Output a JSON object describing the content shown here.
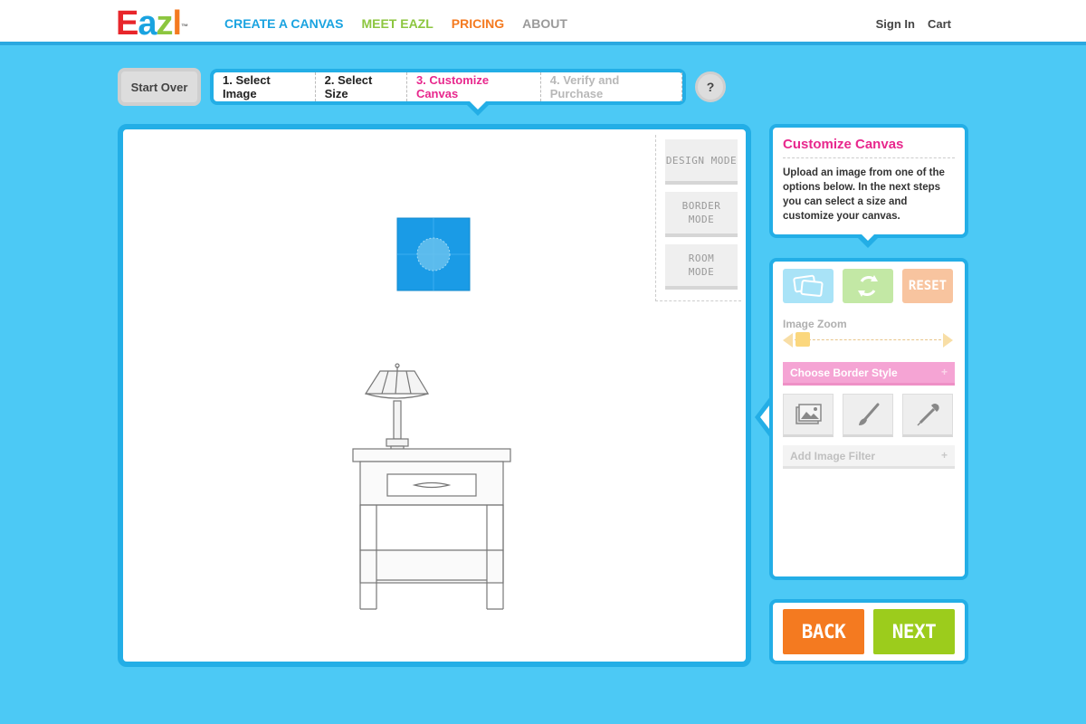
{
  "header": {
    "logo": {
      "letters": [
        "E",
        "a",
        "z",
        "l"
      ],
      "mark": "™"
    },
    "nav": [
      {
        "label": "CREATE A CANVAS",
        "color": "#1aa3e0"
      },
      {
        "label": "MEET EAZL",
        "color": "#8cc63f"
      },
      {
        "label": "PRICING",
        "color": "#f47a20"
      },
      {
        "label": "ABOUT",
        "color": "#9a9a9a"
      }
    ],
    "sign_in": "Sign In",
    "cart": "Cart"
  },
  "steps_bar": {
    "start_over": "Start Over",
    "steps": [
      {
        "label": "1. Select Image",
        "color": "#222222"
      },
      {
        "label": "2. Select Size",
        "color": "#222222"
      },
      {
        "label": "3. Customize Canvas",
        "color": "#e8288d"
      },
      {
        "label": "4. Verify and Purchase",
        "color": "#b8b8b8"
      }
    ],
    "help": "?"
  },
  "canvas": {
    "modes": [
      {
        "label": "DESIGN MODE"
      },
      {
        "label": "BORDER MODE"
      },
      {
        "label": "ROOM MODE"
      }
    ],
    "preview_color": "#1a9be6"
  },
  "info": {
    "title": "Customize Canvas",
    "text": "Upload an image from one of the options below. In the next steps you can select a size and customize your canvas."
  },
  "tools": {
    "top_buttons": [
      {
        "icon": "photos-icon",
        "color": "#a9e3f7"
      },
      {
        "icon": "rotate-icon",
        "color": "#c3e8a5"
      },
      {
        "icon": "reset",
        "label": "RESET",
        "color": "#f8c49f"
      }
    ],
    "zoom_label": "Image Zoom",
    "zoom_level": 0,
    "border_style": "Choose Border Style",
    "border_style_plus": "+",
    "icon_buttons": [
      "image-icon",
      "paintbrush-icon",
      "eyedropper-icon"
    ],
    "filter": "Add Image Filter",
    "filter_plus": "+"
  },
  "navigation": {
    "back": "BACK",
    "back_color": "#f47a20",
    "next": "NEXT",
    "next_color": "#9ccc1c"
  }
}
